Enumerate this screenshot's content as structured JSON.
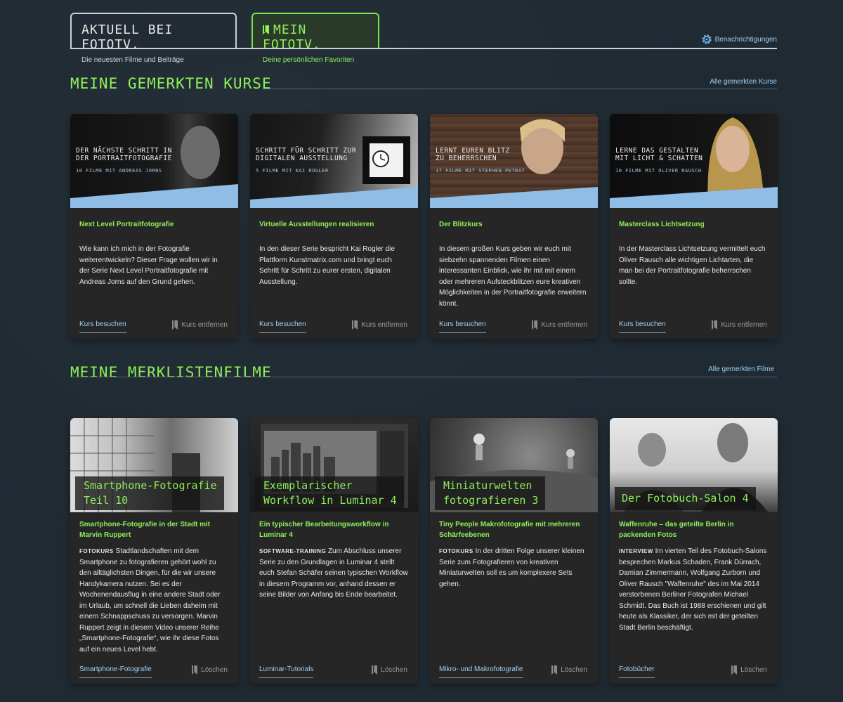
{
  "tabs": [
    {
      "title": "AKTUELL BEI FOTOTV.",
      "subtitle": "Die neuesten Filme und Beiträge"
    },
    {
      "title": "MEIN FOTOTV.",
      "subtitle": "Deine persönlichen Favoriten"
    }
  ],
  "notifications": "Benachrichtigungen",
  "courses_section": {
    "title": "MEINE GEMERKTEN KURSE",
    "link": "Alle gemerkten Kurse"
  },
  "films_section": {
    "title": "MEINE MERKLISTENFILME",
    "link": "Alle gemerkten Filme"
  },
  "courses": [
    {
      "img_title_1": "DER NÄCHSTE SCHRITT IN",
      "img_title_2": "DER PORTRAITFOTOGRAFIE",
      "img_sub": "10 FILME MIT ANDREAS JORNS",
      "title": "Next Level Portraitfotografie",
      "desc": "Wie kann ich mich in der Fotografie weiterentwickeln? Dieser Frage wollen wir in der Serie Next Level Portraitfotografie mit Andreas Jorns auf den Grund gehen.",
      "link": "Kurs besuchen",
      "remove": "Kurs entfernen"
    },
    {
      "img_title_1": "SCHRITT FÜR SCHRITT ZUR",
      "img_title_2": "DIGITALEN AUSSTELLUNG",
      "img_sub": "5 FILME MIT KAI ROGLER",
      "title": "Virtuelle Ausstellungen realisieren",
      "desc": "In den dieser Serie bespricht Kai Rogler die Plattform Kunstmatrix.com und bringt euch Schritt für Schritt zu eurer ersten, digitalen Ausstellung.",
      "link": "Kurs besuchen",
      "remove": "Kurs entfernen"
    },
    {
      "img_title_1": "LERNT EUREN BLITZ",
      "img_title_2": "ZU BEHERRSCHEN",
      "img_sub": "17 FILME MIT STEPHEN PETRAT",
      "title": "Der Blitzkurs",
      "desc": "In diesem großen Kurs geben wir euch mit siebzehn spannenden Filmen einen interessanten Einblick, wie ihr mit mit einem oder mehreren Aufsteckblitzen eure kreativen Möglichkeiten in der Portraitfotografie erweitern könnt.",
      "link": "Kurs besuchen",
      "remove": "Kurs entfernen"
    },
    {
      "img_title_1": "LERNE DAS GESTALTEN",
      "img_title_2": "MIT LICHT & SCHATTEN",
      "img_sub": "10 FILME MIT OLIVER RAUSCH",
      "title": "Masterclass Lichtsetzung",
      "desc": "In der Masterclass Lichtsetzung vermittelt euch Oliver Rausch alle wichtigen Lichtarten, die man bei der Portraitfotografie beherrschen sollte.",
      "link": "Kurs besuchen",
      "remove": "Kurs entfernen"
    }
  ],
  "films": [
    {
      "img_label_1": "Smartphone-Fotografie",
      "img_label_2": "Teil 10",
      "title": "Smartphone-Fotografie in der Stadt mit Marvin Ruppert",
      "category": "FOTOKURS",
      "desc": "Stadtlandschaften mit dem Smartphone zu fotografieren gehört wohl zu den alltäglichsten Dingen, für die wir unsere Handykamera nutzen. Sei es der Wochenendausflug in eine andere Stadt oder im Urlaub, um schnell die Lieben daheim mit einem Schnappschuss zu versorgen. Marvin Ruppert zeigt in diesem Video unserer Reihe „Smartphone-Fotografie“, wie ihr diese Fotos auf ein neues Level hebt.",
      "link": "Smartphone-Fotografie",
      "remove": "Löschen"
    },
    {
      "img_label_1": "Exemplarischer",
      "img_label_2": "Workflow in Luminar 4",
      "title": "Ein typischer Bearbeitungsworkflow in Luminar 4",
      "category": "SOFTWARE-TRAINING",
      "desc": "Zum Abschluss unserer Serie zu den Grundlagen in Luminar 4 stellt euch Stefan Schäfer seinen typischen Workflow in diesem Programm vor, anhand dessen er seine Bilder von Anfang bis Ende bearbeitet.",
      "link": "Luminar-Tutorials",
      "remove": "Löschen"
    },
    {
      "img_label_1": "Miniaturwelten",
      "img_label_2": "fotografieren 3",
      "title": "Tiny People Makrofotografie mit mehreren Schärfeebenen",
      "category": "FOTOKURS",
      "desc": "In der dritten Folge unserer kleinen Serie zum Fotografieren von kreativen Miniaturwelten soll es um komplexere Sets gehen.",
      "link": "Mikro- und Makrofotografie",
      "remove": "Löschen"
    },
    {
      "img_label_1": "Der Fotobuch-Salon 4",
      "img_label_2": "",
      "title": "Waffenruhe – das geteilte Berlin in packenden Fotos",
      "category": "INTERVIEW",
      "desc": "Im vierten Teil des Fotobuch-Salons besprechen Markus Schaden, Frank Dürrach, Damian Zimmermann, Wolfgang Zurborn und Oliver Rausch \"Waffenruhe\" des im Mai 2014 verstorbenen Berliner Fotografen Michael Schmidt. Das Buch ist 1988 erschienen und gilt heute als Klassiker, der sich mit der geteilten Stadt Berlin beschäftigt.",
      "link": "Fotobücher",
      "remove": "Löschen"
    }
  ]
}
